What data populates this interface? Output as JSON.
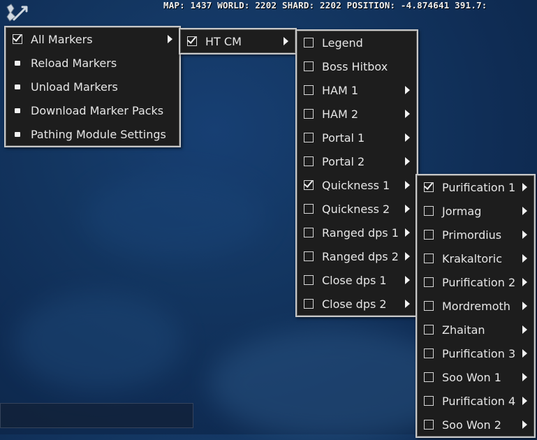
{
  "hud": {
    "text": "MAP: 1437 WORLD: 2202 SHARD: 2202 POSITION: -4.874641 391.7:"
  },
  "main_menu": {
    "items": [
      {
        "label": "All Markers",
        "kind": "checkbox",
        "checked": true,
        "submenu": true
      },
      {
        "label": "Reload Markers",
        "kind": "bullet",
        "submenu": false
      },
      {
        "label": "Unload Markers",
        "kind": "bullet",
        "submenu": false
      },
      {
        "label": "Download Marker Packs",
        "kind": "bullet",
        "submenu": false
      },
      {
        "label": "Pathing Module Settings",
        "kind": "bullet",
        "submenu": false
      }
    ]
  },
  "pack_menu": {
    "items": [
      {
        "label": "HT CM",
        "kind": "checkbox",
        "checked": true,
        "submenu": true
      }
    ]
  },
  "category_menu": {
    "items": [
      {
        "label": "Legend",
        "checked": false,
        "submenu": false
      },
      {
        "label": "Boss Hitbox",
        "checked": false,
        "submenu": false
      },
      {
        "label": "HAM 1",
        "checked": false,
        "submenu": true
      },
      {
        "label": "HAM 2",
        "checked": false,
        "submenu": true
      },
      {
        "label": "Portal 1",
        "checked": false,
        "submenu": true
      },
      {
        "label": "Portal 2",
        "checked": false,
        "submenu": true
      },
      {
        "label": "Quickness 1",
        "checked": true,
        "submenu": true
      },
      {
        "label": "Quickness 2",
        "checked": false,
        "submenu": true
      },
      {
        "label": "Ranged dps 1",
        "checked": false,
        "submenu": true
      },
      {
        "label": "Ranged dps 2",
        "checked": false,
        "submenu": true
      },
      {
        "label": "Close dps 1",
        "checked": false,
        "submenu": true
      },
      {
        "label": "Close dps 2",
        "checked": false,
        "submenu": true
      }
    ]
  },
  "phase_menu": {
    "items": [
      {
        "label": "Purification 1",
        "checked": true,
        "submenu": true
      },
      {
        "label": "Jormag",
        "checked": false,
        "submenu": true
      },
      {
        "label": "Primordius",
        "checked": false,
        "submenu": true
      },
      {
        "label": "Krakaltoric",
        "checked": false,
        "submenu": true
      },
      {
        "label": "Purification 2",
        "checked": false,
        "submenu": true
      },
      {
        "label": "Mordremoth",
        "checked": false,
        "submenu": true
      },
      {
        "label": "Zhaitan",
        "checked": false,
        "submenu": true
      },
      {
        "label": "Purification 3",
        "checked": false,
        "submenu": true
      },
      {
        "label": "Soo Won 1",
        "checked": false,
        "submenu": true
      },
      {
        "label": "Purification 4",
        "checked": false,
        "submenu": true
      },
      {
        "label": "Soo Won 2",
        "checked": false,
        "submenu": true
      }
    ]
  }
}
